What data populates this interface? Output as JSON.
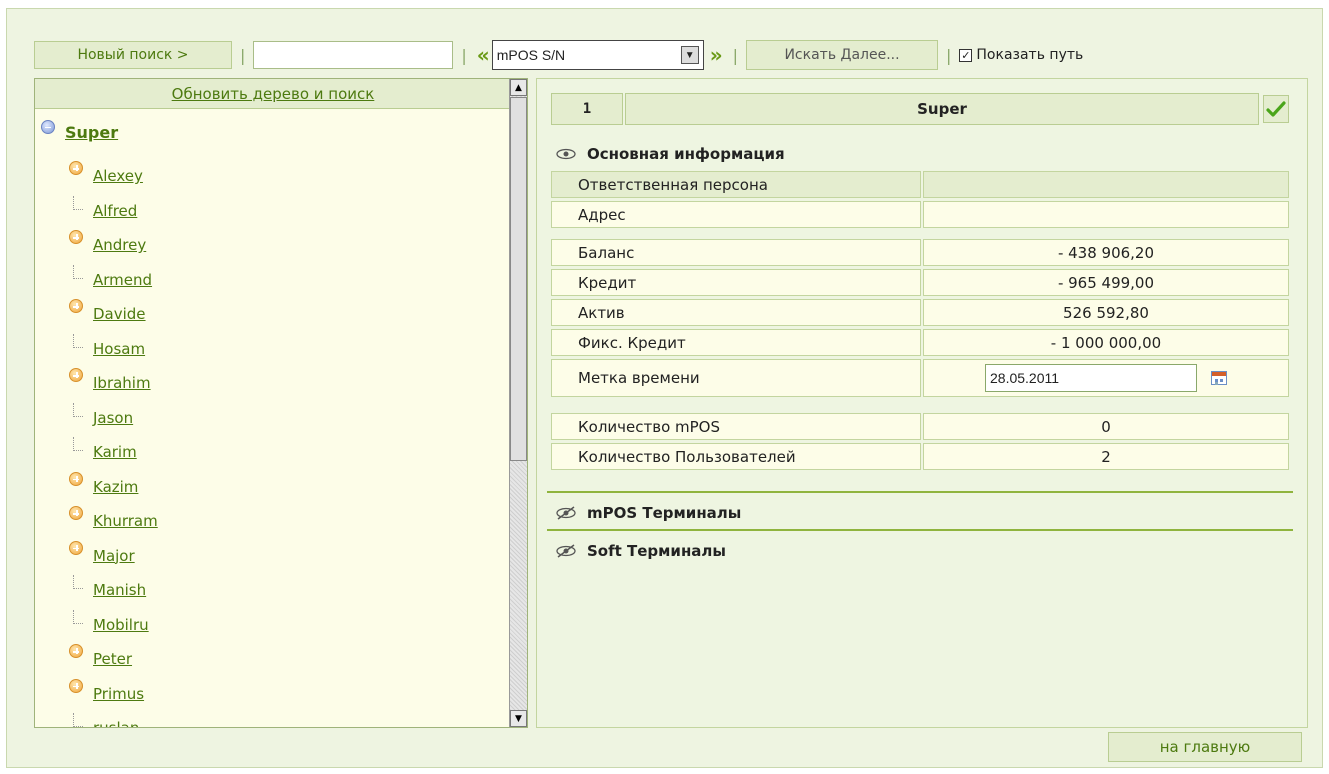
{
  "toolbar": {
    "new_search_label": "Новый поиск >",
    "search_value": "",
    "prev_arrows": "«",
    "select_value": "mPOS S/N",
    "next_arrows": "»",
    "search_next_label": "Искать Далее...",
    "show_path_label": "Показать путь",
    "show_path_checked": true
  },
  "tree": {
    "refresh_label": "Обновить дерево и поиск",
    "root": "Super",
    "items": [
      {
        "label": "Alexey",
        "expandable": true
      },
      {
        "label": "Alfred",
        "expandable": false
      },
      {
        "label": "Andrey",
        "expandable": true
      },
      {
        "label": "Armend",
        "expandable": false
      },
      {
        "label": "Davide",
        "expandable": true
      },
      {
        "label": "Hosam",
        "expandable": false
      },
      {
        "label": "Ibrahim",
        "expandable": true
      },
      {
        "label": "Jason",
        "expandable": false
      },
      {
        "label": "Karim",
        "expandable": false
      },
      {
        "label": "Kazim",
        "expandable": true
      },
      {
        "label": "Khurram",
        "expandable": true
      },
      {
        "label": "Major",
        "expandable": true
      },
      {
        "label": "Manish",
        "expandable": false
      },
      {
        "label": "Mobilru",
        "expandable": false
      },
      {
        "label": "Peter",
        "expandable": true
      },
      {
        "label": "Primus",
        "expandable": true
      },
      {
        "label": "ruslan",
        "expandable": false
      }
    ]
  },
  "detail": {
    "number": "1",
    "name": "Super",
    "main_section_title": "Основная информация",
    "rows": [
      {
        "label": "Ответственная персона",
        "value": ""
      },
      {
        "label": "Адрес",
        "value": ""
      },
      {
        "label": "Баланс",
        "value": "- 438 906,20"
      },
      {
        "label": "Кредит",
        "value": "- 965 499,00"
      },
      {
        "label": "Актив",
        "value": "526 592,80"
      },
      {
        "label": "Фикс. Кредит",
        "value": "- 1 000 000,00"
      },
      {
        "label": "Метка времени",
        "value": "28.05.2011"
      },
      {
        "label": "Количество mPOS",
        "value": "0"
      },
      {
        "label": "Количество Пользователей",
        "value": "2"
      }
    ],
    "mpos_section_title": "mPOS Терминалы",
    "soft_section_title": "Soft Терминалы"
  },
  "footer": {
    "home_label": "на главную"
  },
  "colors": {
    "accent_green": "#4d7a10",
    "panel_bg": "#eef5e1",
    "tree_bg": "#fdfde8"
  }
}
